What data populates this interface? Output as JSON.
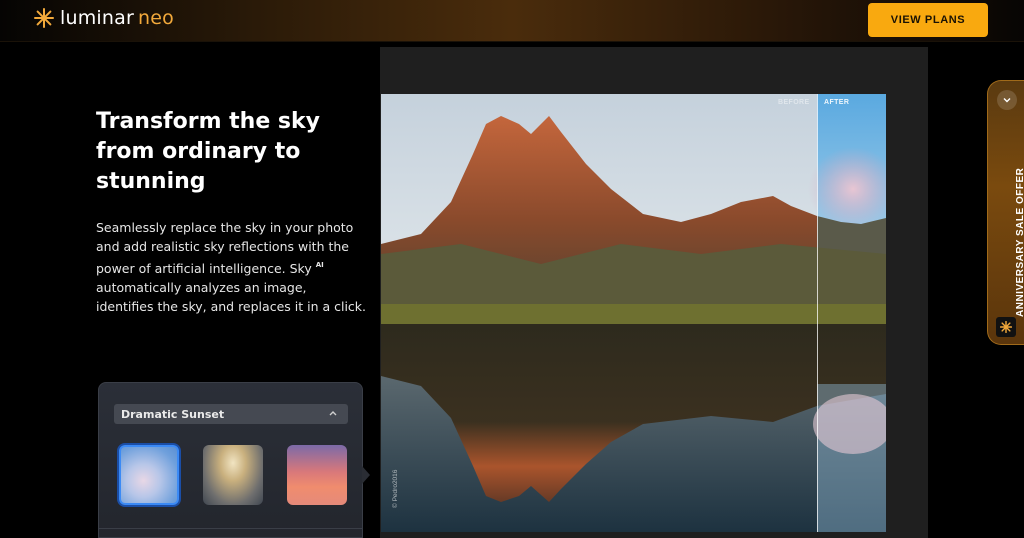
{
  "header": {
    "logo": {
      "brand": "luminar",
      "product": "neo",
      "accent_color": "#f2a93b"
    },
    "cta_label": "VIEW PLANS",
    "cta_color": "#f9a90f"
  },
  "hero": {
    "headline": "Transform the sky from ordinary to stunning",
    "description_before": "Seamlessly replace the sky in your photo and add realistic sky reflections with the power of artificial intelligence. Sky",
    "description_sup": "AI",
    "description_after": " automatically analyzes an image, identifies the sky, and replaces it in a click."
  },
  "sky_panel": {
    "selected_preset": "Dramatic Sunset",
    "thumbnails": [
      {
        "name": "sky-thumbnail-blue-clouds",
        "selected": true
      },
      {
        "name": "sky-thumbnail-cloudy",
        "selected": false
      },
      {
        "name": "sky-thumbnail-sunset",
        "selected": false
      }
    ],
    "selection_color": "#3b8af5"
  },
  "comparison": {
    "before_label": "BEFORE",
    "after_label": "AFTER",
    "photo_credit": "© Pedro2016"
  },
  "offer_tab": {
    "label": "ANNIVERSARY SALE OFFER",
    "icons": [
      "chevron-down-icon",
      "sparkle-icon"
    ]
  }
}
